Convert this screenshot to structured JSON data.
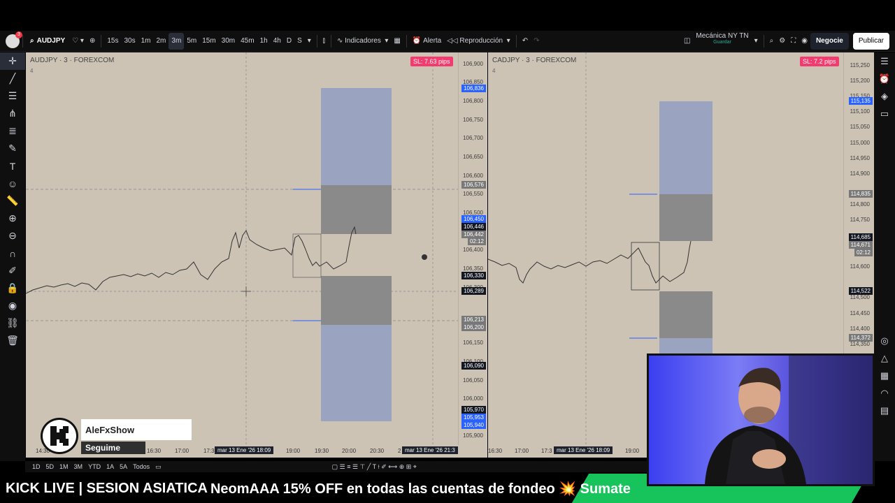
{
  "toolbar": {
    "notif_count": "3",
    "symbol": "AUDJPY",
    "intervals": [
      "15s",
      "30s",
      "1m",
      "2m",
      "3m",
      "5m",
      "15m",
      "30m",
      "45m",
      "1h",
      "4h",
      "D",
      "S"
    ],
    "active_interval": "3m",
    "indicators_label": "Indicadores",
    "alert_label": "Alerta",
    "replay_label": "Reproducción",
    "layout_name": "Mecánica NY TN",
    "layout_saved": "Guardar",
    "trade_label": "Negocie",
    "publish_label": "Publicar"
  },
  "left_chart": {
    "title": "AUDJPY · 3 · FOREXCOM",
    "sub": "4",
    "sl_badge": "SL: 7.63 pips",
    "price_ticks": [
      "106,900",
      "106,850",
      "106,800",
      "106,750",
      "106,700",
      "106,650",
      "106,600",
      "106,550",
      "106,500",
      "106,450",
      "106,400",
      "106,350",
      "106,300",
      "106,250",
      "106,200",
      "106,150",
      "106,100",
      "106,050",
      "106,000",
      "105,950",
      "105,900"
    ],
    "labels": [
      {
        "text": "106,836",
        "color": "#2962ff"
      },
      {
        "text": "106,576",
        "color": "#787878"
      },
      {
        "text": "106,450",
        "color": "#2962ff"
      },
      {
        "text": "106,446",
        "color": "#131722"
      },
      {
        "text": "106,442",
        "color": "#787878"
      },
      {
        "text": "02:12",
        "color": "#787878"
      },
      {
        "text": "106,330",
        "color": "#131722"
      },
      {
        "text": "106,289",
        "color": "#131722"
      },
      {
        "text": "106,213",
        "color": "#787878"
      },
      {
        "text": "106,200",
        "color": "#787878"
      },
      {
        "text": "106,090",
        "color": "#131722"
      },
      {
        "text": "105,970",
        "color": "#131722"
      },
      {
        "text": "105,953",
        "color": "#2962ff"
      },
      {
        "text": "105,940",
        "color": "#2962ff"
      }
    ],
    "time_ticks": [
      "14:30",
      "16:30",
      "17:00",
      "17:3",
      "19:00",
      "19:30",
      "20:00",
      "20:30",
      "2"
    ],
    "time_cursor": "mar 13 Ene '26   18:09",
    "time_cursor2": "mar 13 Ene '26   21:3"
  },
  "right_chart": {
    "title": "CADJPY · 3 · FOREXCOM",
    "sub": "4",
    "sl_badge": "SL: 7.2 pips",
    "price_ticks": [
      "115,250",
      "115,200",
      "115,150",
      "115,100",
      "115,050",
      "115,000",
      "114,950",
      "114,900",
      "114,850",
      "114,800",
      "114,750",
      "114,700",
      "114,650",
      "114,600",
      "114,550",
      "114,500",
      "114,450",
      "114,400",
      "114,350"
    ],
    "labels": [
      {
        "text": "115,135",
        "color": "#2962ff"
      },
      {
        "text": "114,835",
        "color": "#787878"
      },
      {
        "text": "114,685",
        "color": "#131722"
      },
      {
        "text": "114,671",
        "color": "#787878"
      },
      {
        "text": "02:12",
        "color": "#787878"
      },
      {
        "text": "114,522",
        "color": "#131722"
      },
      {
        "text": "114,372",
        "color": "#787878"
      }
    ],
    "time_ticks": [
      "16:30",
      "17:00",
      "17:3",
      "19:00"
    ],
    "time_cursor": "mar 13 Ene '26   18:09"
  },
  "ranges": [
    "1D",
    "5D",
    "1M",
    "3M",
    "YTD",
    "1A",
    "5A",
    "Todos"
  ],
  "ticker": {
    "live": "KICK LIVE | SESION ASIATICA",
    "message": "NeomAAA 15% OFF en todas las cuentas de fondeo 💥 Sumate"
  },
  "kick": {
    "name": "AleFxShow",
    "follow": "Seguime"
  },
  "colors": {
    "chart_bg": "#cdc3b4",
    "target_zone": "#9aa3c0",
    "risk_zone": "#8a8a8a",
    "sl_badge": "#f23c6f",
    "kick_green": "#17c45c"
  }
}
